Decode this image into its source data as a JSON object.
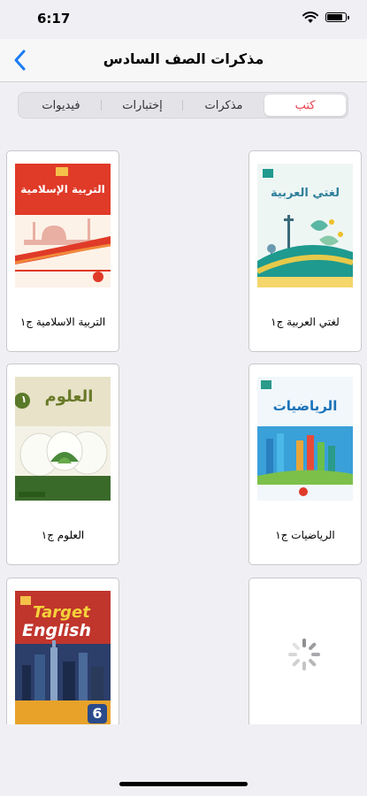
{
  "status_bar": {
    "time": "6:17"
  },
  "nav": {
    "title": "مذكرات  الصف السادس"
  },
  "tabs": [
    {
      "label": "كتب",
      "selected": true
    },
    {
      "label": "مذكرات",
      "selected": false
    },
    {
      "label": "إختبارات",
      "selected": false
    },
    {
      "label": "فيديوات",
      "selected": false
    }
  ],
  "books": [
    {
      "label": "لغتي العربية ج١",
      "cover_title": "لغتي العربية"
    },
    {
      "label": "التربية الاسلامية ج١",
      "cover_title": "التربية الإسلامية"
    },
    {
      "label": "الرياضيات ج١",
      "cover_title": "الرياضيات"
    },
    {
      "label": "العلوم ج١",
      "cover_title": "العلوم",
      "cover_number": "١"
    },
    {
      "cover_title_1": "Target",
      "cover_title_2": "English",
      "cover_number": "6"
    }
  ],
  "colors": {
    "accent": "#e8404a",
    "nav_tint": "#1a7cf5"
  }
}
